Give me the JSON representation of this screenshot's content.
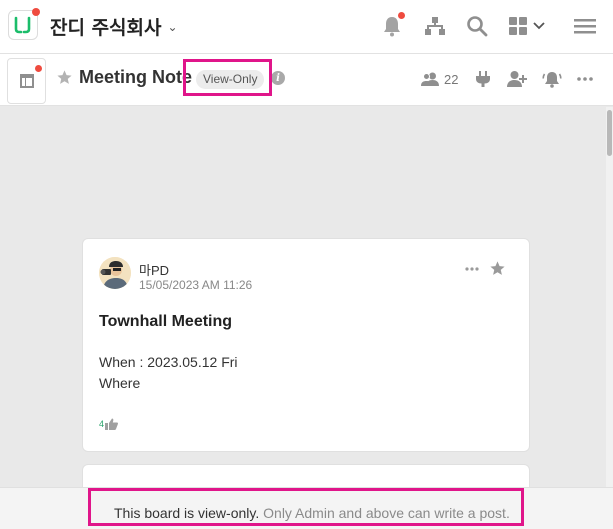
{
  "app": {
    "company_name": "잔디 주식회사",
    "brand_color": "#1bbd6a",
    "notification_dot_color": "#ef4b3f",
    "highlight_color": "#e0158a"
  },
  "topbar": {
    "icons": [
      "notification-bell-icon",
      "org-chart-icon",
      "search-icon",
      "apps-grid-icon",
      "menu-icon"
    ]
  },
  "topic": {
    "title": "Meeting Note",
    "badge": "View-Only",
    "member_count": "22"
  },
  "feed": {
    "posts": [
      {
        "author": "마PD",
        "date": "15/05/2023 AM 11:26",
        "title": "Townhall Meeting",
        "lines": [
          "When : 2023.05.12 Fri",
          "Where"
        ],
        "likes": "4"
      }
    ]
  },
  "footer": {
    "notice_main": "This board is view-only.",
    "notice_sub": "Only Admin and above can write a post."
  }
}
